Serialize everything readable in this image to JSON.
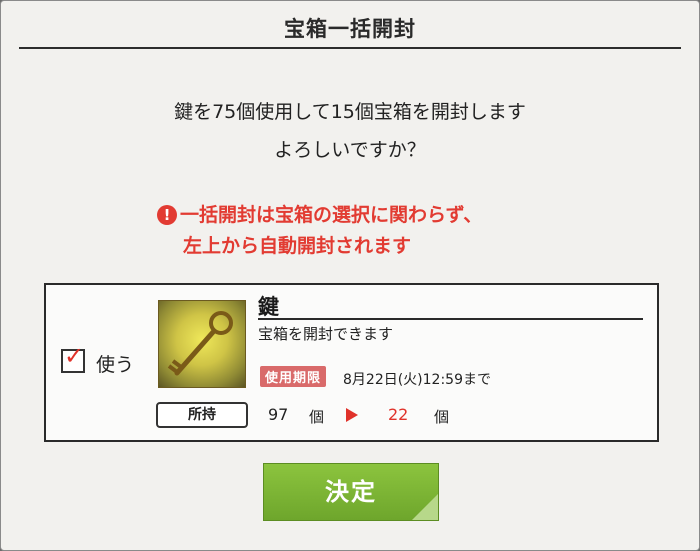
{
  "dialog": {
    "title": "宝箱一括開封",
    "confirm_line1": "鍵を75個使用して15個宝箱を開封します",
    "confirm_line2": "よろしいですか？",
    "warning_icon": "!",
    "warning_line1": "一括開封は宝箱の選択に関わらず、",
    "warning_line2": "左上から自動開封されます"
  },
  "item": {
    "use_label": "使う",
    "use_checked": true,
    "name": "鍵",
    "description": "宝箱を開封できます",
    "expiry_badge": "使用期限",
    "expiry_text": "8月22日(火)12:59まで",
    "owned_label": "所持",
    "owned_count": "97",
    "owned_unit": "個",
    "after_count": "22",
    "after_unit": "個"
  },
  "buttons": {
    "confirm_label": "決定"
  },
  "colors": {
    "accent_red": "#e23b32",
    "button_green": "#7cb536",
    "badge_pink": "#d96a6a"
  }
}
